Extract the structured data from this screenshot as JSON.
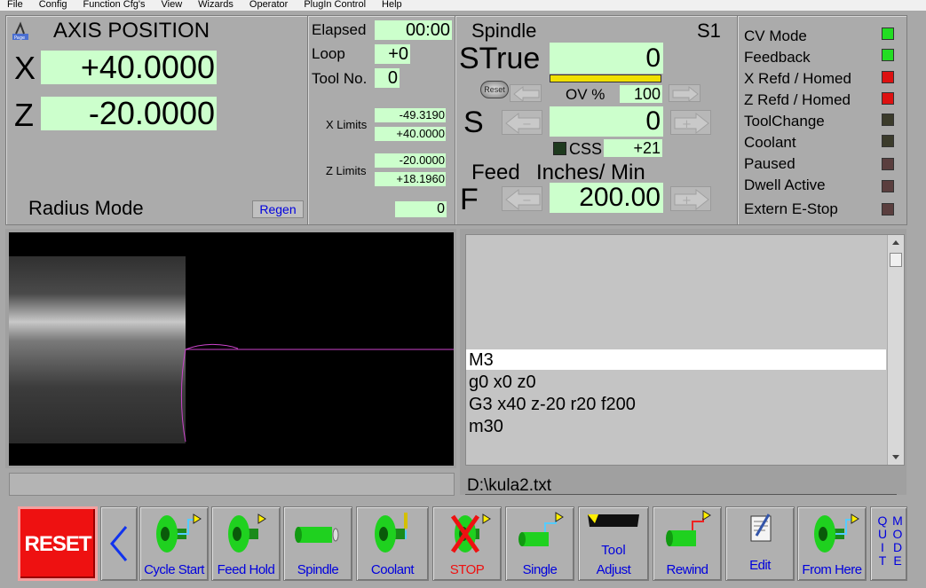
{
  "menu": [
    "File",
    "Config",
    "Function Cfg's",
    "View",
    "Wizards",
    "Operator",
    "PlugIn Control",
    "Help"
  ],
  "axis": {
    "title": "AXIS POSITION",
    "x_label": "X",
    "x_value": "+40.0000",
    "z_label": "Z",
    "z_value": "-20.0000",
    "mode": "Radius Mode",
    "regen": "Regen"
  },
  "status": {
    "elapsed_label": "Elapsed",
    "elapsed_value": "00:00",
    "loop_label": "Loop",
    "loop_value": "+0",
    "tool_label": "Tool No.",
    "tool_value": "0",
    "xlim_label": "X Limits",
    "xlim_min": "-49.3190",
    "xlim_max": "+40.0000",
    "zlim_label": "Z Limits",
    "zlim_min": "-20.0000",
    "zlim_max": "+18.1960",
    "line_value": "0"
  },
  "spindle": {
    "title": "Spindle",
    "id": "S1",
    "strue_label": "STrue",
    "strue_value": "0",
    "reset": "Reset",
    "ov_label": "OV %",
    "ov_value": "100",
    "s_label": "S",
    "s_value": "0",
    "css_label": "CSS",
    "css_value": "+21",
    "feed_label": "Feed",
    "feed_units": "Inches/ Min",
    "f_label": "F",
    "f_value": "200.00",
    "minus": "−",
    "plus": "+"
  },
  "leds": [
    {
      "label": "CV Mode",
      "color": "#22dd22"
    },
    {
      "label": "Feedback",
      "color": "#22dd22"
    },
    {
      "label": "X Refd / Homed",
      "color": "#dd1111"
    },
    {
      "label": "Z Refd / Homed",
      "color": "#dd1111"
    },
    {
      "label": "ToolChange",
      "color": "#3b3b2b"
    },
    {
      "label": "Coolant",
      "color": "#3b3b2b"
    },
    {
      "label": "Paused",
      "color": "#5a3e3e"
    },
    {
      "label": "Dwell Active",
      "color": "#5a3e3e"
    },
    {
      "label": "Extern E-Stop",
      "color": "#5a3e3e"
    }
  ],
  "gcode": {
    "lines": [
      "M3",
      "g0 x0 z0",
      "G3 x40 z-20 r20 f200",
      "m30"
    ],
    "file": "D:\\kula2.txt"
  },
  "toolbar": {
    "reset": "RESET",
    "cycle_start": "Cycle Start",
    "feed_hold": "Feed Hold",
    "spindle": "Spindle",
    "coolant": "Coolant",
    "stop": "STOP",
    "single": "Single",
    "tool_adjust_1": "Tool",
    "tool_adjust_2": "Adjust",
    "rewind": "Rewind",
    "edit": "Edit",
    "from_here": "From Here",
    "quit_letters": [
      "Q",
      "U",
      "I",
      "T"
    ],
    "mode_letters": [
      "M",
      "O",
      "D",
      "E"
    ]
  },
  "icons": {
    "back": "chevron-left-icon",
    "logo": "mach-logo-icon"
  }
}
